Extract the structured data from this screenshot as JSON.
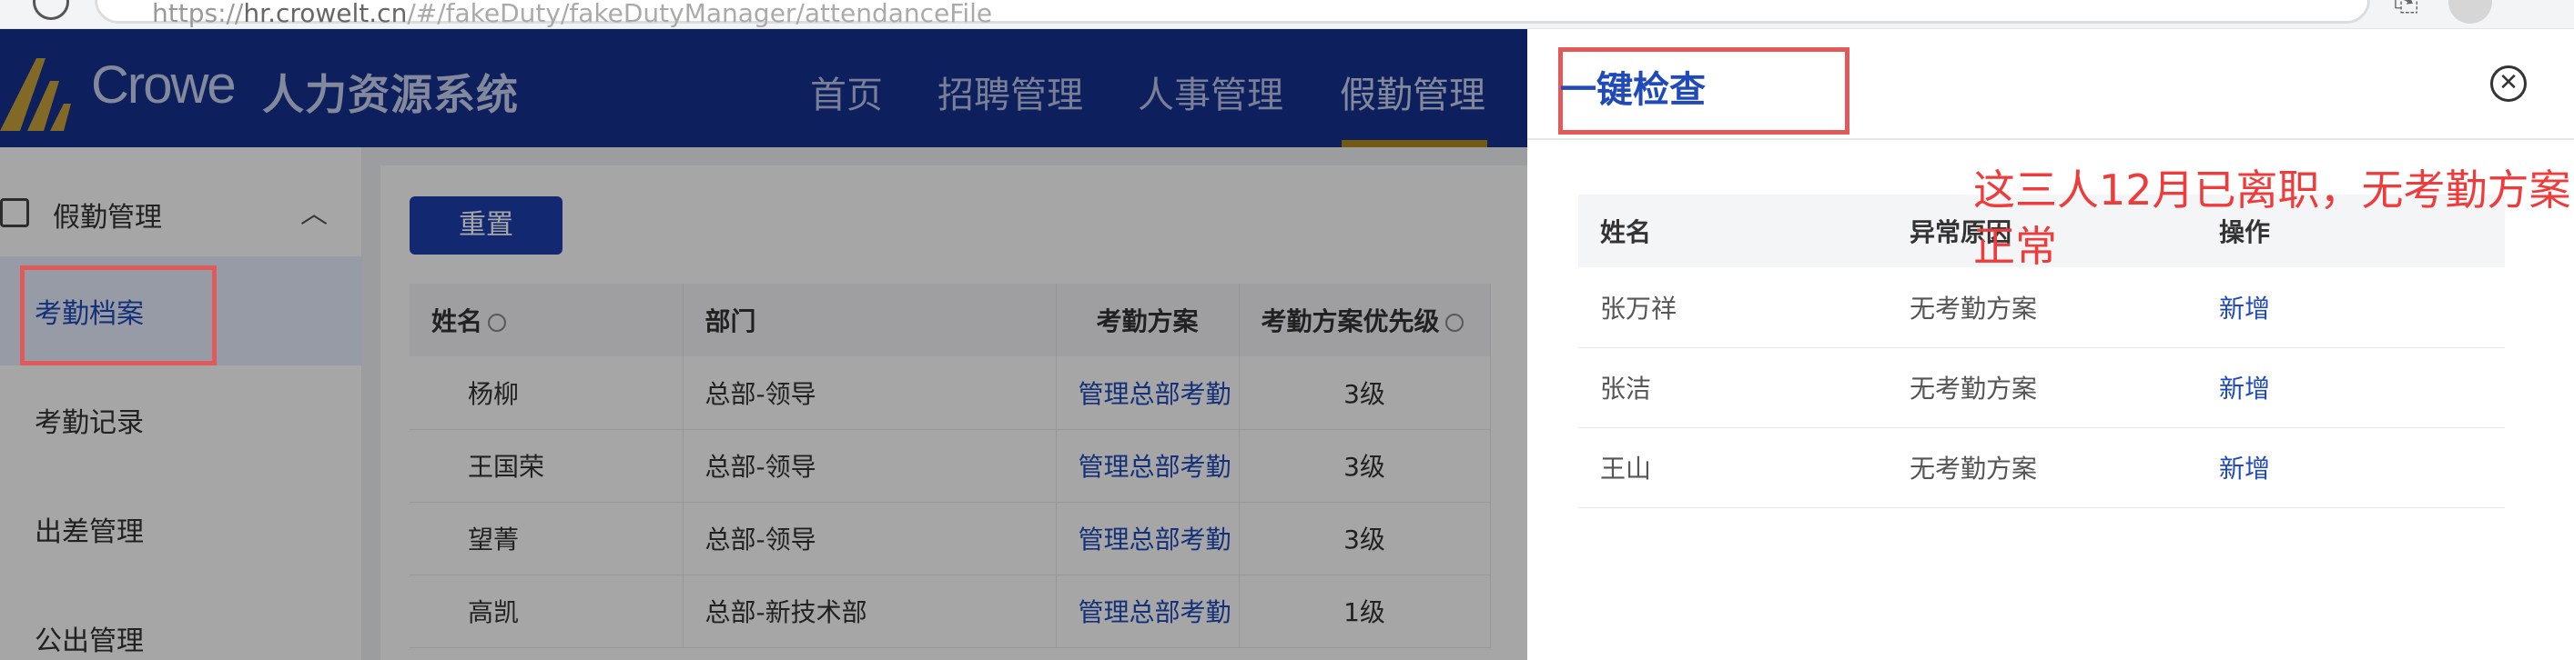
{
  "browser": {
    "url_scheme": "https://",
    "url_host": "hr.crowelt.cn",
    "url_rest": "/#/fakeDuty/fakeDutyManager/attendanceFile"
  },
  "header": {
    "brand": "Crowe",
    "system_name": "人力资源系统",
    "nav": [
      "首页",
      "招聘管理",
      "人事管理",
      "假勤管理"
    ],
    "active_nav": "假勤管理"
  },
  "sidebar": {
    "group_label": "假勤管理",
    "items": [
      {
        "label": "考勤档案",
        "active": true
      },
      {
        "label": "考勤记录",
        "active": false
      },
      {
        "label": "出差管理",
        "active": false
      },
      {
        "label": "公出管理",
        "active": false
      }
    ]
  },
  "content": {
    "reset_button": "重置",
    "columns": [
      "姓名",
      "部门",
      "考勤方案",
      "考勤方案优先级"
    ],
    "rows": [
      {
        "name": "杨柳",
        "dept": "总部-领导",
        "scheme": "管理总部考勤",
        "priority": "3级"
      },
      {
        "name": "王国荣",
        "dept": "总部-领导",
        "scheme": "管理总部考勤",
        "priority": "3级"
      },
      {
        "name": "望菁",
        "dept": "总部-领导",
        "scheme": "管理总部考勤",
        "priority": "3级"
      },
      {
        "name": "高凯",
        "dept": "总部-新技术部",
        "scheme": "管理总部考勤",
        "priority": "1级"
      }
    ]
  },
  "drawer": {
    "title": "一键检查",
    "columns": [
      "姓名",
      "异常原因",
      "操作"
    ],
    "rows": [
      {
        "name": "张万祥",
        "reason": "无考勤方案",
        "action": "新增"
      },
      {
        "name": "张洁",
        "reason": "无考勤方案",
        "action": "新增"
      },
      {
        "name": "王山",
        "reason": "无考勤方案",
        "action": "新增"
      }
    ],
    "annotation": "这三人12月已离职，无考勤方案正常"
  },
  "colors": {
    "header_bg": "#14308f",
    "accent_blue": "#1f4ab8",
    "annotation_red": "#ee3b3b",
    "nav_underline": "#b08a21"
  }
}
